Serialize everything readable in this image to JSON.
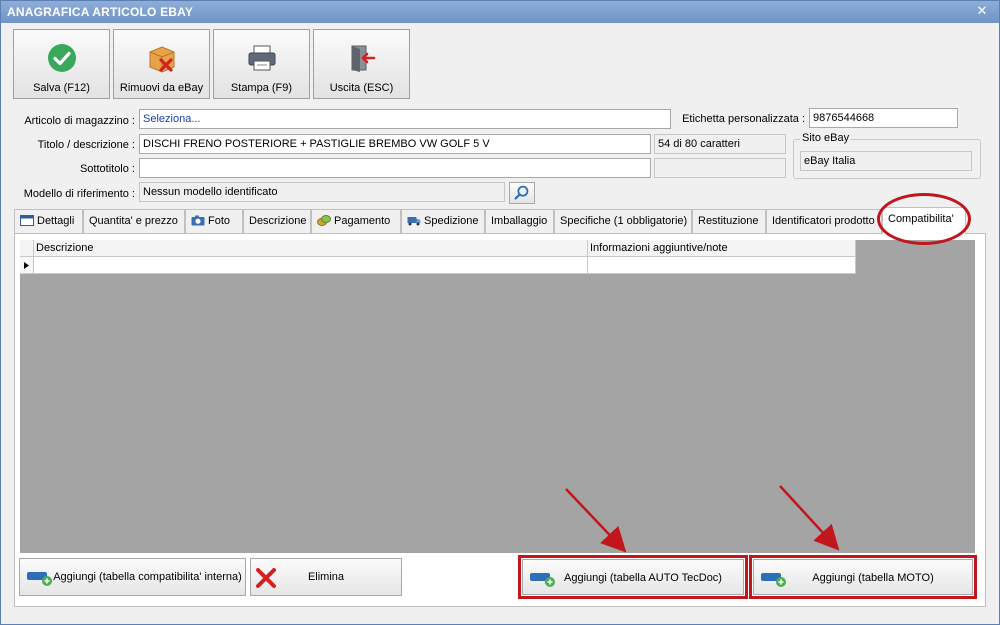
{
  "window": {
    "title": "ANAGRAFICA ARTICOLO EBAY"
  },
  "toolbar": {
    "save_label": "Salva (F12)",
    "remove_label": "Rimuovi da eBay",
    "print_label": "Stampa (F9)",
    "exit_label": "Uscita (ESC)"
  },
  "form": {
    "articolo_label": "Articolo di magazzino :",
    "articolo_value": "Seleziona...",
    "etichetta_label": "Etichetta personalizzata :",
    "etichetta_value": "9876544668",
    "titolo_label": "Titolo / descrizione :",
    "titolo_value": "DISCHI FRENO POSTERIORE + PASTIGLIE BREMBO VW GOLF 5 V",
    "titolo_counter": "54 di 80 caratteri",
    "sottotitolo_label": "Sottotitolo :",
    "sottotitolo_value": "",
    "modello_label": "Modello di riferimento :",
    "modello_value": "Nessun modello identificato",
    "sito_group_title": "Sito eBay",
    "sito_value": "eBay Italia"
  },
  "tabs": [
    {
      "label": "Dettagli",
      "icon": "calendar-icon"
    },
    {
      "label": "Quantita' e prezzo",
      "icon": ""
    },
    {
      "label": "Foto",
      "icon": "camera-icon"
    },
    {
      "label": "Descrizione",
      "icon": ""
    },
    {
      "label": "Pagamento",
      "icon": "coins-icon"
    },
    {
      "label": "Spedizione",
      "icon": "truck-icon"
    },
    {
      "label": "Imballaggio",
      "icon": ""
    },
    {
      "label": "Specifiche (1 obbligatorie)",
      "icon": ""
    },
    {
      "label": "Restituzione",
      "icon": ""
    },
    {
      "label": "Identificatori prodotto",
      "icon": ""
    },
    {
      "label": "Compatibilita'",
      "icon": ""
    }
  ],
  "grid": {
    "columns": [
      "Descrizione",
      "Informazioni aggiuntive/note"
    ],
    "rows": [
      [
        "",
        ""
      ]
    ]
  },
  "bottom": {
    "add_internal_label": "Aggiungi (tabella compatibilita' interna)",
    "delete_label": "Elimina",
    "add_auto_label": "Aggiungi (tabella AUTO TecDoc)",
    "add_moto_label": "Aggiungi (tabella MOTO)"
  },
  "colors": {
    "titlebar": "#7596c9",
    "annotation_red": "#c0161c",
    "grid_background": "#a4a4a4",
    "save_green": "#3aa85a"
  }
}
